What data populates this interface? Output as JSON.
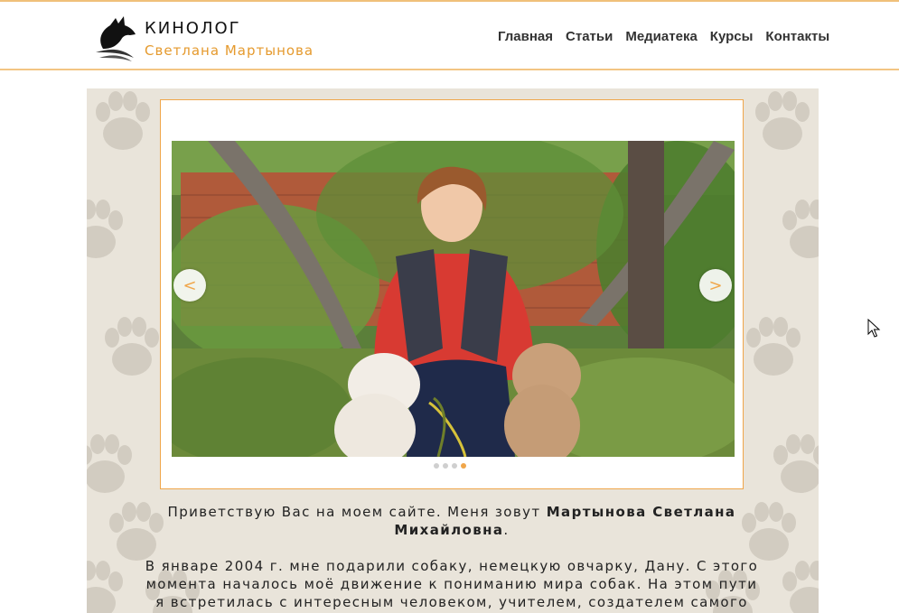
{
  "brand": {
    "title": "КИНОЛОГ",
    "subtitle": "Светлана Мартынова"
  },
  "nav": {
    "items": [
      "Главная",
      "Статьи",
      "Медиатека",
      "Курсы",
      "Контакты"
    ]
  },
  "slider": {
    "prev_label": "<",
    "next_label": ">",
    "slide_count": 4,
    "active_index": 3
  },
  "intro": {
    "p1_prefix": "Приветствую Вас на моем сайте. Меня зовут ",
    "p1_name": "Мартынова Светлана Михайловна",
    "p1_suffix": ".",
    "p2": "В январе 2004 г. мне подарили собаку, немецкую овчарку, Дану. С этого момента началось моё движение к пониманию мира собак. На этом пути я встретилась с интересным человеком, учителем, создателем самого"
  },
  "colors": {
    "accent": "#f0a64a",
    "panel_bg": "#e9e4da"
  }
}
